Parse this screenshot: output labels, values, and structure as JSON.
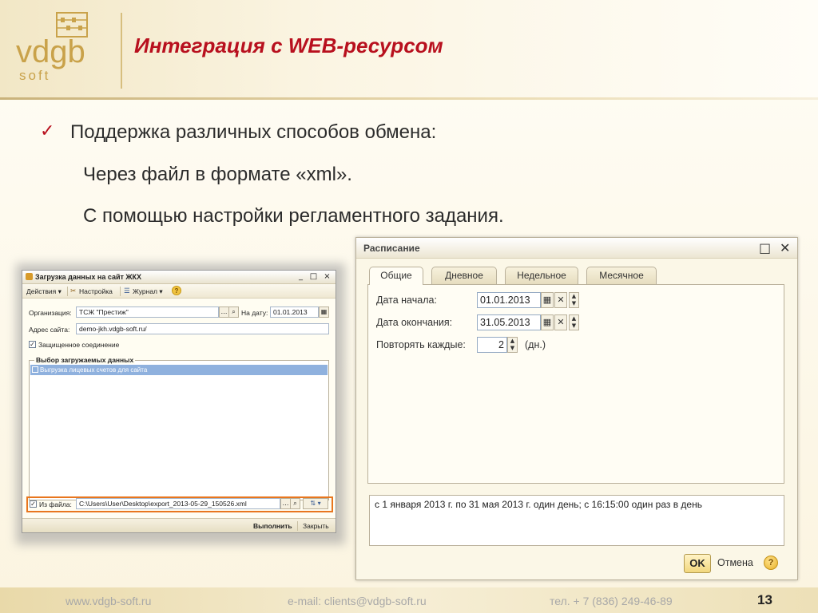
{
  "header": {
    "logo": {
      "brand_main": "vdgb",
      "brand_sub": "soft"
    },
    "title": "Интеграция с WEB-ресурсом"
  },
  "bullets": {
    "check_icon": "checkmark-icon",
    "main": "Поддержка различных способов обмена:",
    "sub1": "Через файл в формате «xml».",
    "sub2": "С помощью настройки регламентного задания."
  },
  "upload_window": {
    "title": "Загрузка данных на сайт ЖКХ",
    "controls": {
      "minimize": "_",
      "maximize": "□",
      "close": "×"
    },
    "toolbar": {
      "actions": "Действия ▾",
      "settings": "Настройка",
      "journal": "Журнал ▾",
      "help": "?"
    },
    "organization_label": "Организация:",
    "organization_value": "ТСЖ \"Престиж\"",
    "date_label": "На дату:",
    "date_value": "01.01.2013",
    "site_label": "Адрес сайта:",
    "site_value": "demo-jkh.vdgb-soft.ru/",
    "secure_label": "Защищенное соединение",
    "secure_checked": true,
    "group_title": "Выбор загружаемых данных",
    "list_items": [
      "Выгрузка лицевых счетов для сайта"
    ],
    "from_file_label": "Из файла:",
    "from_file_checked": true,
    "file_path": "C:\\Users\\User\\Desktop\\export_2013-05-29_150526.xml",
    "run_label": "Выполнить",
    "close_label": "Закрыть"
  },
  "schedule_window": {
    "title": "Расписание",
    "controls": {
      "maximize": "□",
      "close": "✕"
    },
    "tabs": [
      {
        "label": "Общие",
        "active": true
      },
      {
        "label": "Дневное",
        "active": false
      },
      {
        "label": "Недельное",
        "active": false
      },
      {
        "label": "Месячное",
        "active": false
      }
    ],
    "start_label": "Дата начала:",
    "start_value": "01.01.2013",
    "end_label": "Дата окончания:",
    "end_value": "31.05.2013",
    "repeat_label": "Повторять каждые:",
    "repeat_value": "2",
    "repeat_unit": "(дн.)",
    "summary": "с 1 января 2013 г. по 31 мая 2013 г. один день; с 16:15:00 один раз в день",
    "ok_label": "OK",
    "cancel_label": "Отмена",
    "help_label": "?"
  },
  "footer": {
    "website": "www.vdgb-soft.ru",
    "email": "e-mail: clients@vdgb-soft.ru",
    "phone": "тел. + 7 (836) 249-46-89",
    "page_number": "13"
  },
  "colors": {
    "title_red": "#b8101e",
    "logo_gold": "#c9a24a",
    "footer_gold": "#e9d9a9",
    "highlight_orange": "#e8761e"
  }
}
